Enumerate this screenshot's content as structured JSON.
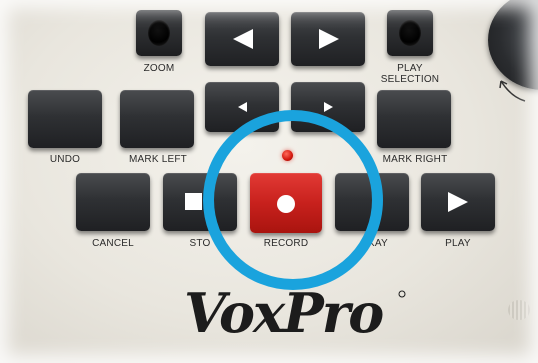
{
  "device": {
    "brand_logo": "VoxPro"
  },
  "buttons": {
    "zoom": "ZOOM",
    "play_selection_line1": "PLAY",
    "play_selection_line2": "SELECTION",
    "undo": "UNDO",
    "mark_left": "MARK LEFT",
    "mark_right": "MARK RIGHT",
    "cancel": "CANCEL",
    "stop": "STO",
    "record": "RECORD",
    "okay": "KAY",
    "play": "PLAY"
  },
  "icons": {
    "prev": "triangle-left-icon",
    "next": "triangle-right-icon",
    "nudge_left": "small-triangle-left-icon",
    "nudge_right": "small-triangle-right-icon",
    "record": "record-dot-icon",
    "stop": "stop-square-icon",
    "play": "play-triangle-icon"
  },
  "colors": {
    "highlight_ring": "#1aa3dd",
    "record_button": "#c8211d",
    "led": "#d2160d"
  }
}
